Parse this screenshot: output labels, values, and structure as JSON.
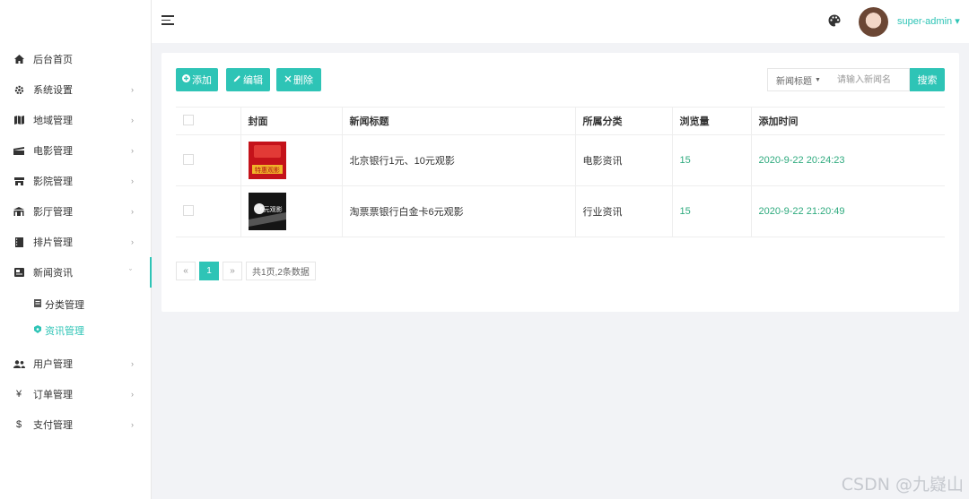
{
  "sidebar": {
    "items": [
      {
        "label": "后台首页",
        "icon": "home-icon"
      },
      {
        "label": "系统设置",
        "icon": "gear-icon",
        "arrow": "›"
      },
      {
        "label": "地域管理",
        "icon": "map-icon",
        "arrow": "›"
      },
      {
        "label": "电影管理",
        "icon": "film-icon",
        "arrow": "›"
      },
      {
        "label": "影院管理",
        "icon": "cinema-icon",
        "arrow": "›"
      },
      {
        "label": "影厅管理",
        "icon": "hall-icon",
        "arrow": "›"
      },
      {
        "label": "排片管理",
        "icon": "schedule-icon",
        "arrow": "›"
      },
      {
        "label": "新闻资讯",
        "icon": "news-icon",
        "arrow": "ˇ"
      },
      {
        "label": "用户管理",
        "icon": "users-icon",
        "arrow": "›"
      },
      {
        "label": "订单管理",
        "icon": "yen-icon",
        "symbol": "¥",
        "arrow": "›"
      },
      {
        "label": "支付管理",
        "icon": "dollar-icon",
        "symbol": "$",
        "arrow": "›"
      }
    ],
    "sub_items": [
      {
        "label": "分类管理",
        "icon": "category-icon"
      },
      {
        "label": "资讯管理",
        "icon": "news-item-icon"
      }
    ]
  },
  "header": {
    "user_name": "super-admin ▾"
  },
  "toolbar": {
    "add_label": "添加",
    "edit_label": "编辑",
    "delete_label": "删除",
    "search_field": "新闻标题",
    "search_placeholder": "请输入新闻名",
    "search_button": "搜索"
  },
  "table": {
    "columns": [
      "封面",
      "新闻标题",
      "所属分类",
      "浏览量",
      "添加时间"
    ],
    "rows": [
      {
        "title": "北京银行1元、10元观影",
        "category": "电影资讯",
        "views": "15",
        "time": "2020-9-22 20:24:23",
        "cover_text": "特惠观影"
      },
      {
        "title": "淘票票银行白金卡6元观影",
        "category": "行业资讯",
        "views": "15",
        "time": "2020-9-22 21:20:49",
        "cover_text": "6元观影"
      }
    ]
  },
  "pager": {
    "prev": "«",
    "current": "1",
    "next": "»",
    "info": "共1页,2条数据"
  },
  "colors": {
    "accent": "#2ec4b6",
    "green_text": "#2eaa7e"
  },
  "watermark": "CSDN @九嶷山"
}
